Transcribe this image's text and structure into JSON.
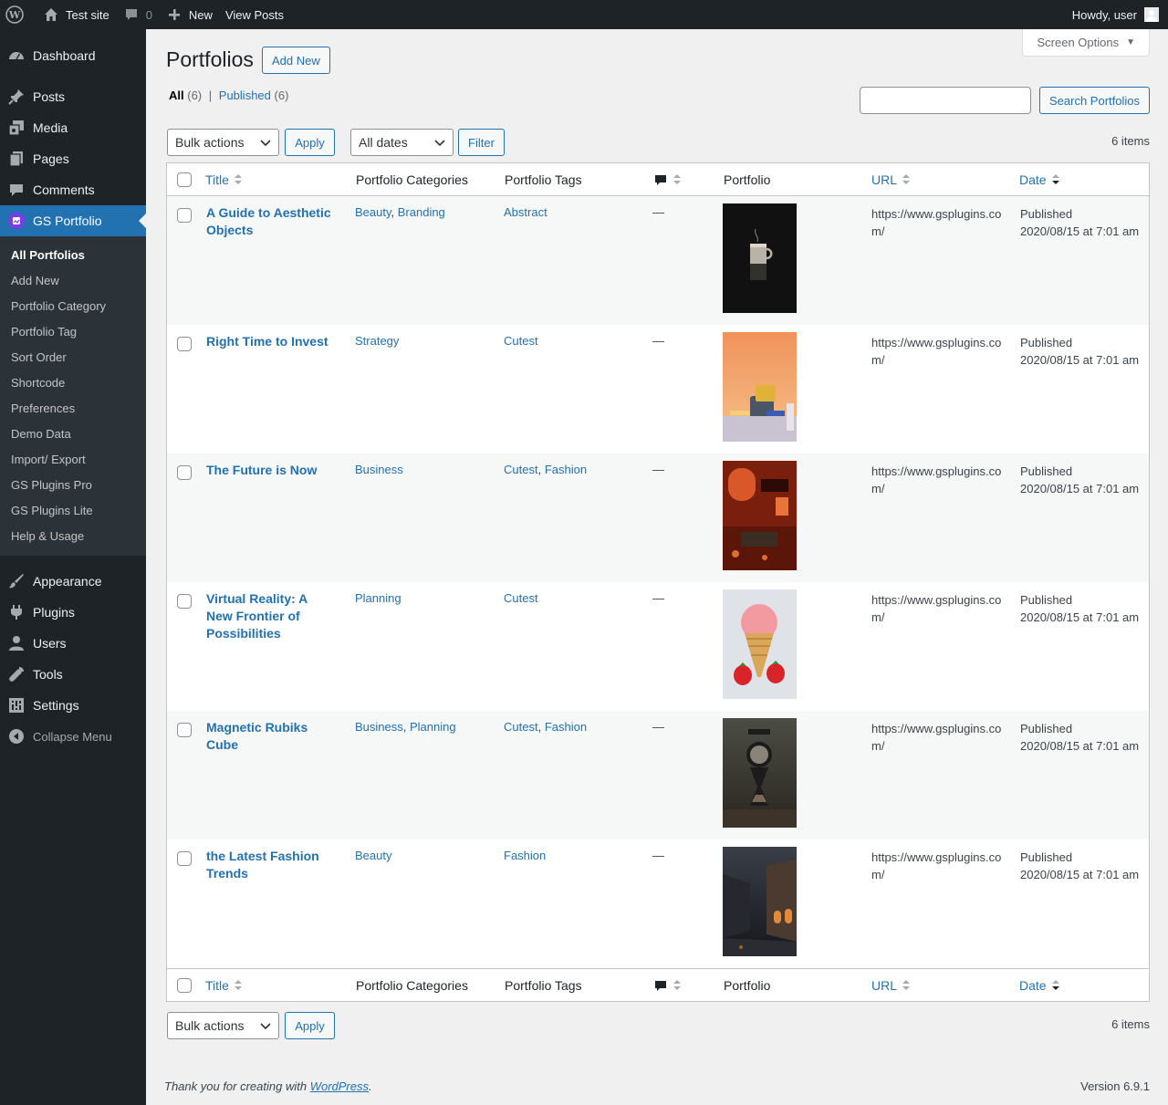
{
  "adminbar": {
    "site_name": "Test site",
    "comments_count": "0",
    "new_label": "New",
    "view_posts": "View Posts",
    "howdy": "Howdy, user"
  },
  "sidebar": {
    "items_top": [
      {
        "label": "Dashboard",
        "icon": "dashboard-icon"
      },
      {
        "label": "Posts",
        "icon": "pin-icon"
      },
      {
        "label": "Media",
        "icon": "media-icon"
      },
      {
        "label": "Pages",
        "icon": "pages-icon"
      },
      {
        "label": "Comments",
        "icon": "comment-icon"
      }
    ],
    "active": {
      "label": "GS Portfolio",
      "icon": "portfolio-icon"
    },
    "submenu": [
      "All Portfolios",
      "Add New",
      "Portfolio Category",
      "Portfolio Tag",
      "Sort Order",
      "Shortcode",
      "Preferences",
      "Demo Data",
      "Import/ Export",
      "GS Plugins Pro",
      "GS Plugins Lite",
      "Help & Usage"
    ],
    "items_bottom": [
      {
        "label": "Appearance",
        "icon": "brush-icon"
      },
      {
        "label": "Plugins",
        "icon": "plug-icon"
      },
      {
        "label": "Users",
        "icon": "user-icon"
      },
      {
        "label": "Tools",
        "icon": "wrench-icon"
      },
      {
        "label": "Settings",
        "icon": "settings-icon"
      }
    ],
    "collapse": "Collapse Menu"
  },
  "page": {
    "title": "Portfolios",
    "add_new": "Add New",
    "screen_options": "Screen Options",
    "filter_all": "All",
    "filter_all_count": "(6)",
    "filter_published": "Published",
    "filter_published_count": "(6)",
    "search_button": "Search Portfolios",
    "bulk_actions": "Bulk actions",
    "apply": "Apply",
    "all_dates": "All dates",
    "filter": "Filter",
    "items_count": "6 items"
  },
  "table": {
    "columns": {
      "title": "Title",
      "categories": "Portfolio Categories",
      "tags": "Portfolio Tags",
      "portfolio": "Portfolio",
      "url": "URL",
      "date": "Date"
    },
    "rows": [
      {
        "title": "A Guide to Aesthetic Objects",
        "cats": [
          "Beauty",
          "Branding"
        ],
        "tags": [
          "Abstract"
        ],
        "comments": "—",
        "url": "https://www.gsplugins.com/",
        "status": "Published",
        "date": "2020/08/15 at 7:01 am",
        "thumb": "coffee"
      },
      {
        "title": "Right Time to Invest",
        "cats": [
          "Strategy"
        ],
        "tags": [
          "Cutest"
        ],
        "comments": "—",
        "url": "https://www.gsplugins.com/",
        "status": "Published",
        "date": "2020/08/15 at 7:01 am",
        "thumb": "mug"
      },
      {
        "title": "The Future is Now",
        "cats": [
          "Business"
        ],
        "tags": [
          "Cutest",
          "Fashion"
        ],
        "comments": "—",
        "url": "https://www.gsplugins.com/",
        "status": "Published",
        "date": "2020/08/15 at 7:01 am",
        "thumb": "cafe"
      },
      {
        "title": "Virtual Reality: A New Frontier of Possibilities",
        "cats": [
          "Planning"
        ],
        "tags": [
          "Cutest"
        ],
        "comments": "—",
        "url": "https://www.gsplugins.com/",
        "status": "Published",
        "date": "2020/08/15 at 7:01 am",
        "thumb": "icecream"
      },
      {
        "title": "Magnetic Rubiks Cube",
        "cats": [
          "Business",
          "Planning"
        ],
        "tags": [
          "Cutest",
          "Fashion"
        ],
        "comments": "—",
        "url": "https://www.gsplugins.com/",
        "status": "Published",
        "date": "2020/08/15 at 7:01 am",
        "thumb": "hourglass"
      },
      {
        "title": "the Latest Fashion Trends",
        "cats": [
          "Beauty"
        ],
        "tags": [
          "Fashion"
        ],
        "comments": "—",
        "url": "https://www.gsplugins.com/",
        "status": "Published",
        "date": "2020/08/15 at 7:01 am",
        "thumb": "street"
      }
    ]
  },
  "footer": {
    "thanks_prefix": "Thank you for creating with ",
    "thanks_link": "WordPress",
    "thanks_suffix": ".",
    "version": "Version 6.9.1"
  }
}
